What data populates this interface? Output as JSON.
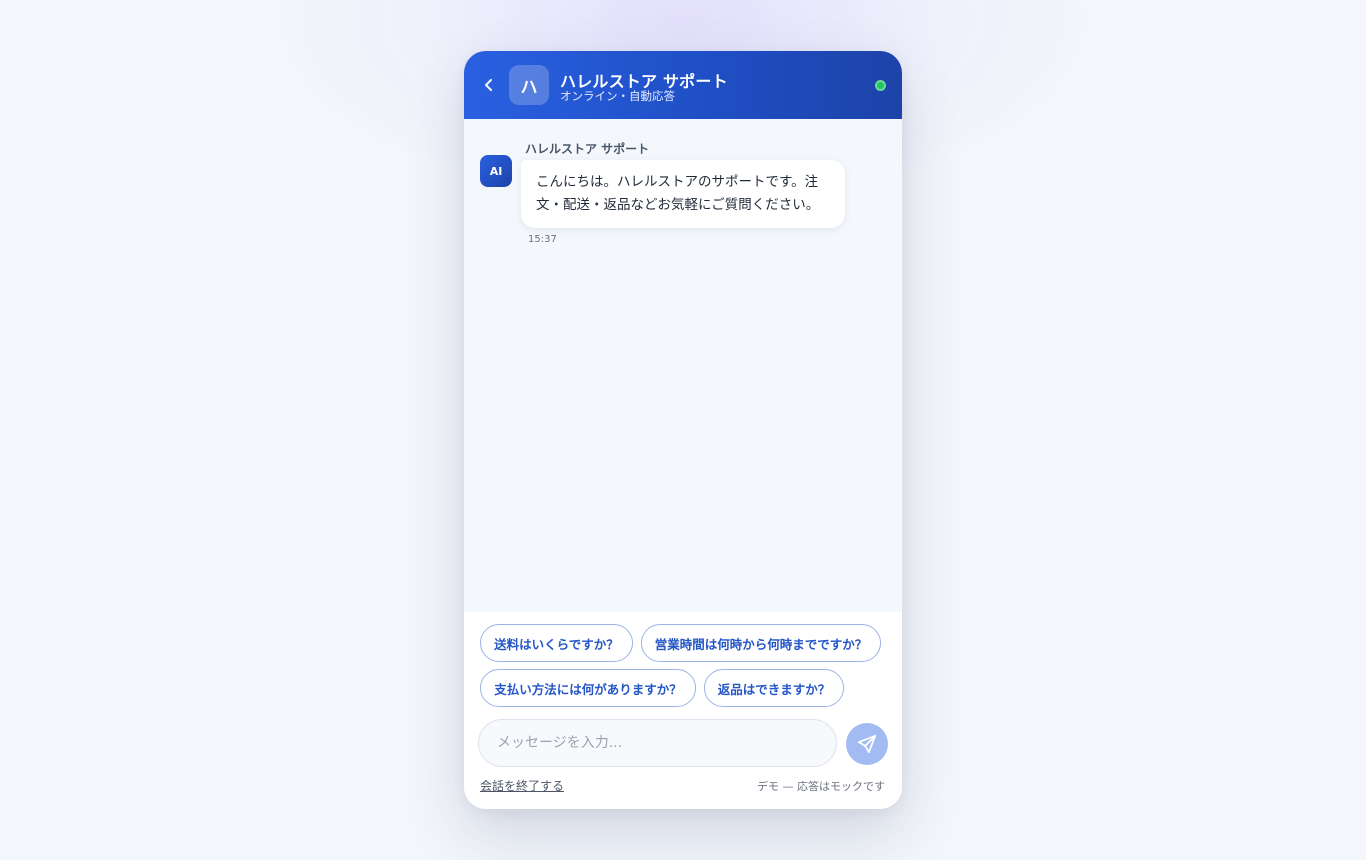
{
  "header": {
    "brand_initial": "ハ",
    "title": "ハレルストア サポート",
    "subtitle": "オンライン・自動応答"
  },
  "messages": [
    {
      "avatar": "AI",
      "sender": "ハレルストア サポート",
      "text": "こんにちは。ハレルストアのサポートです。注文・配送・返品などお気軽にご質問ください。",
      "time": "15:37"
    }
  ],
  "quick_replies": [
    "送料はいくらですか？",
    "営業時間は何時から何時までですか？",
    "支払い方法には何がありますか？",
    "返品はできますか？"
  ],
  "composer": {
    "placeholder": "メッセージを入力...",
    "value": ""
  },
  "footer": {
    "end_label": "会話を終了する",
    "demo_note": "デモ — 応答はモックです"
  },
  "colors": {
    "accent": "#2556c8",
    "header_start": "#2a60e0",
    "header_end": "#1d43a8",
    "online": "#22c55e",
    "send_button": "#a3bbf3"
  },
  "icons": {
    "back": "chevron-left-icon",
    "send": "paper-plane-icon",
    "status": "online-dot-icon"
  }
}
